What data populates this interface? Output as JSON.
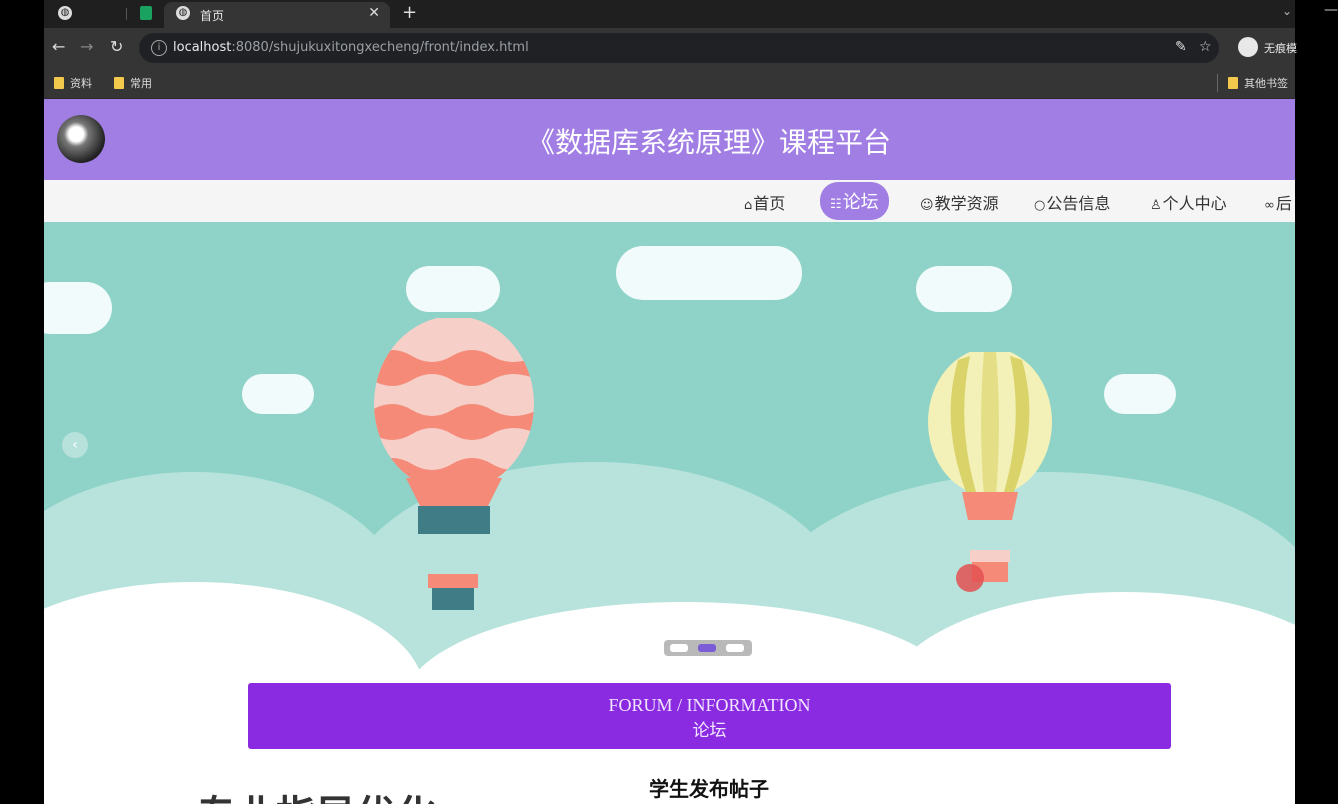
{
  "browser": {
    "tab_title": "首页",
    "url_host": "localhost",
    "url_rest": ":8080/shujukuxitongxecheng/front/index.html",
    "profile_name": "无痕模",
    "bookmarks": [
      "资料",
      "常用"
    ],
    "other_bookmarks": "其他书签"
  },
  "site": {
    "title": "《数据库系统原理》课程平台",
    "menu": [
      {
        "icon": "⌂",
        "label": "首页"
      },
      {
        "icon": "☷",
        "label": "论坛"
      },
      {
        "icon": "☺",
        "label": "教学资源"
      },
      {
        "icon": "○",
        "label": "公告信息"
      },
      {
        "icon": "♙",
        "label": "个人中心"
      },
      {
        "icon": "∞",
        "label": "后"
      }
    ],
    "active_menu": "论坛"
  },
  "banner": {
    "carousel_count": 3,
    "active_index": 1
  },
  "forum_section": {
    "title_en": "FORUM / INFORMATION",
    "title_zh": "论坛",
    "posts_heading": "学生发布帖子",
    "partial_text": "专业指导优化"
  },
  "colors": {
    "header": "#a17ee4",
    "forum_bar": "#8a2be2",
    "banner_sky": "#8fd3c8"
  }
}
